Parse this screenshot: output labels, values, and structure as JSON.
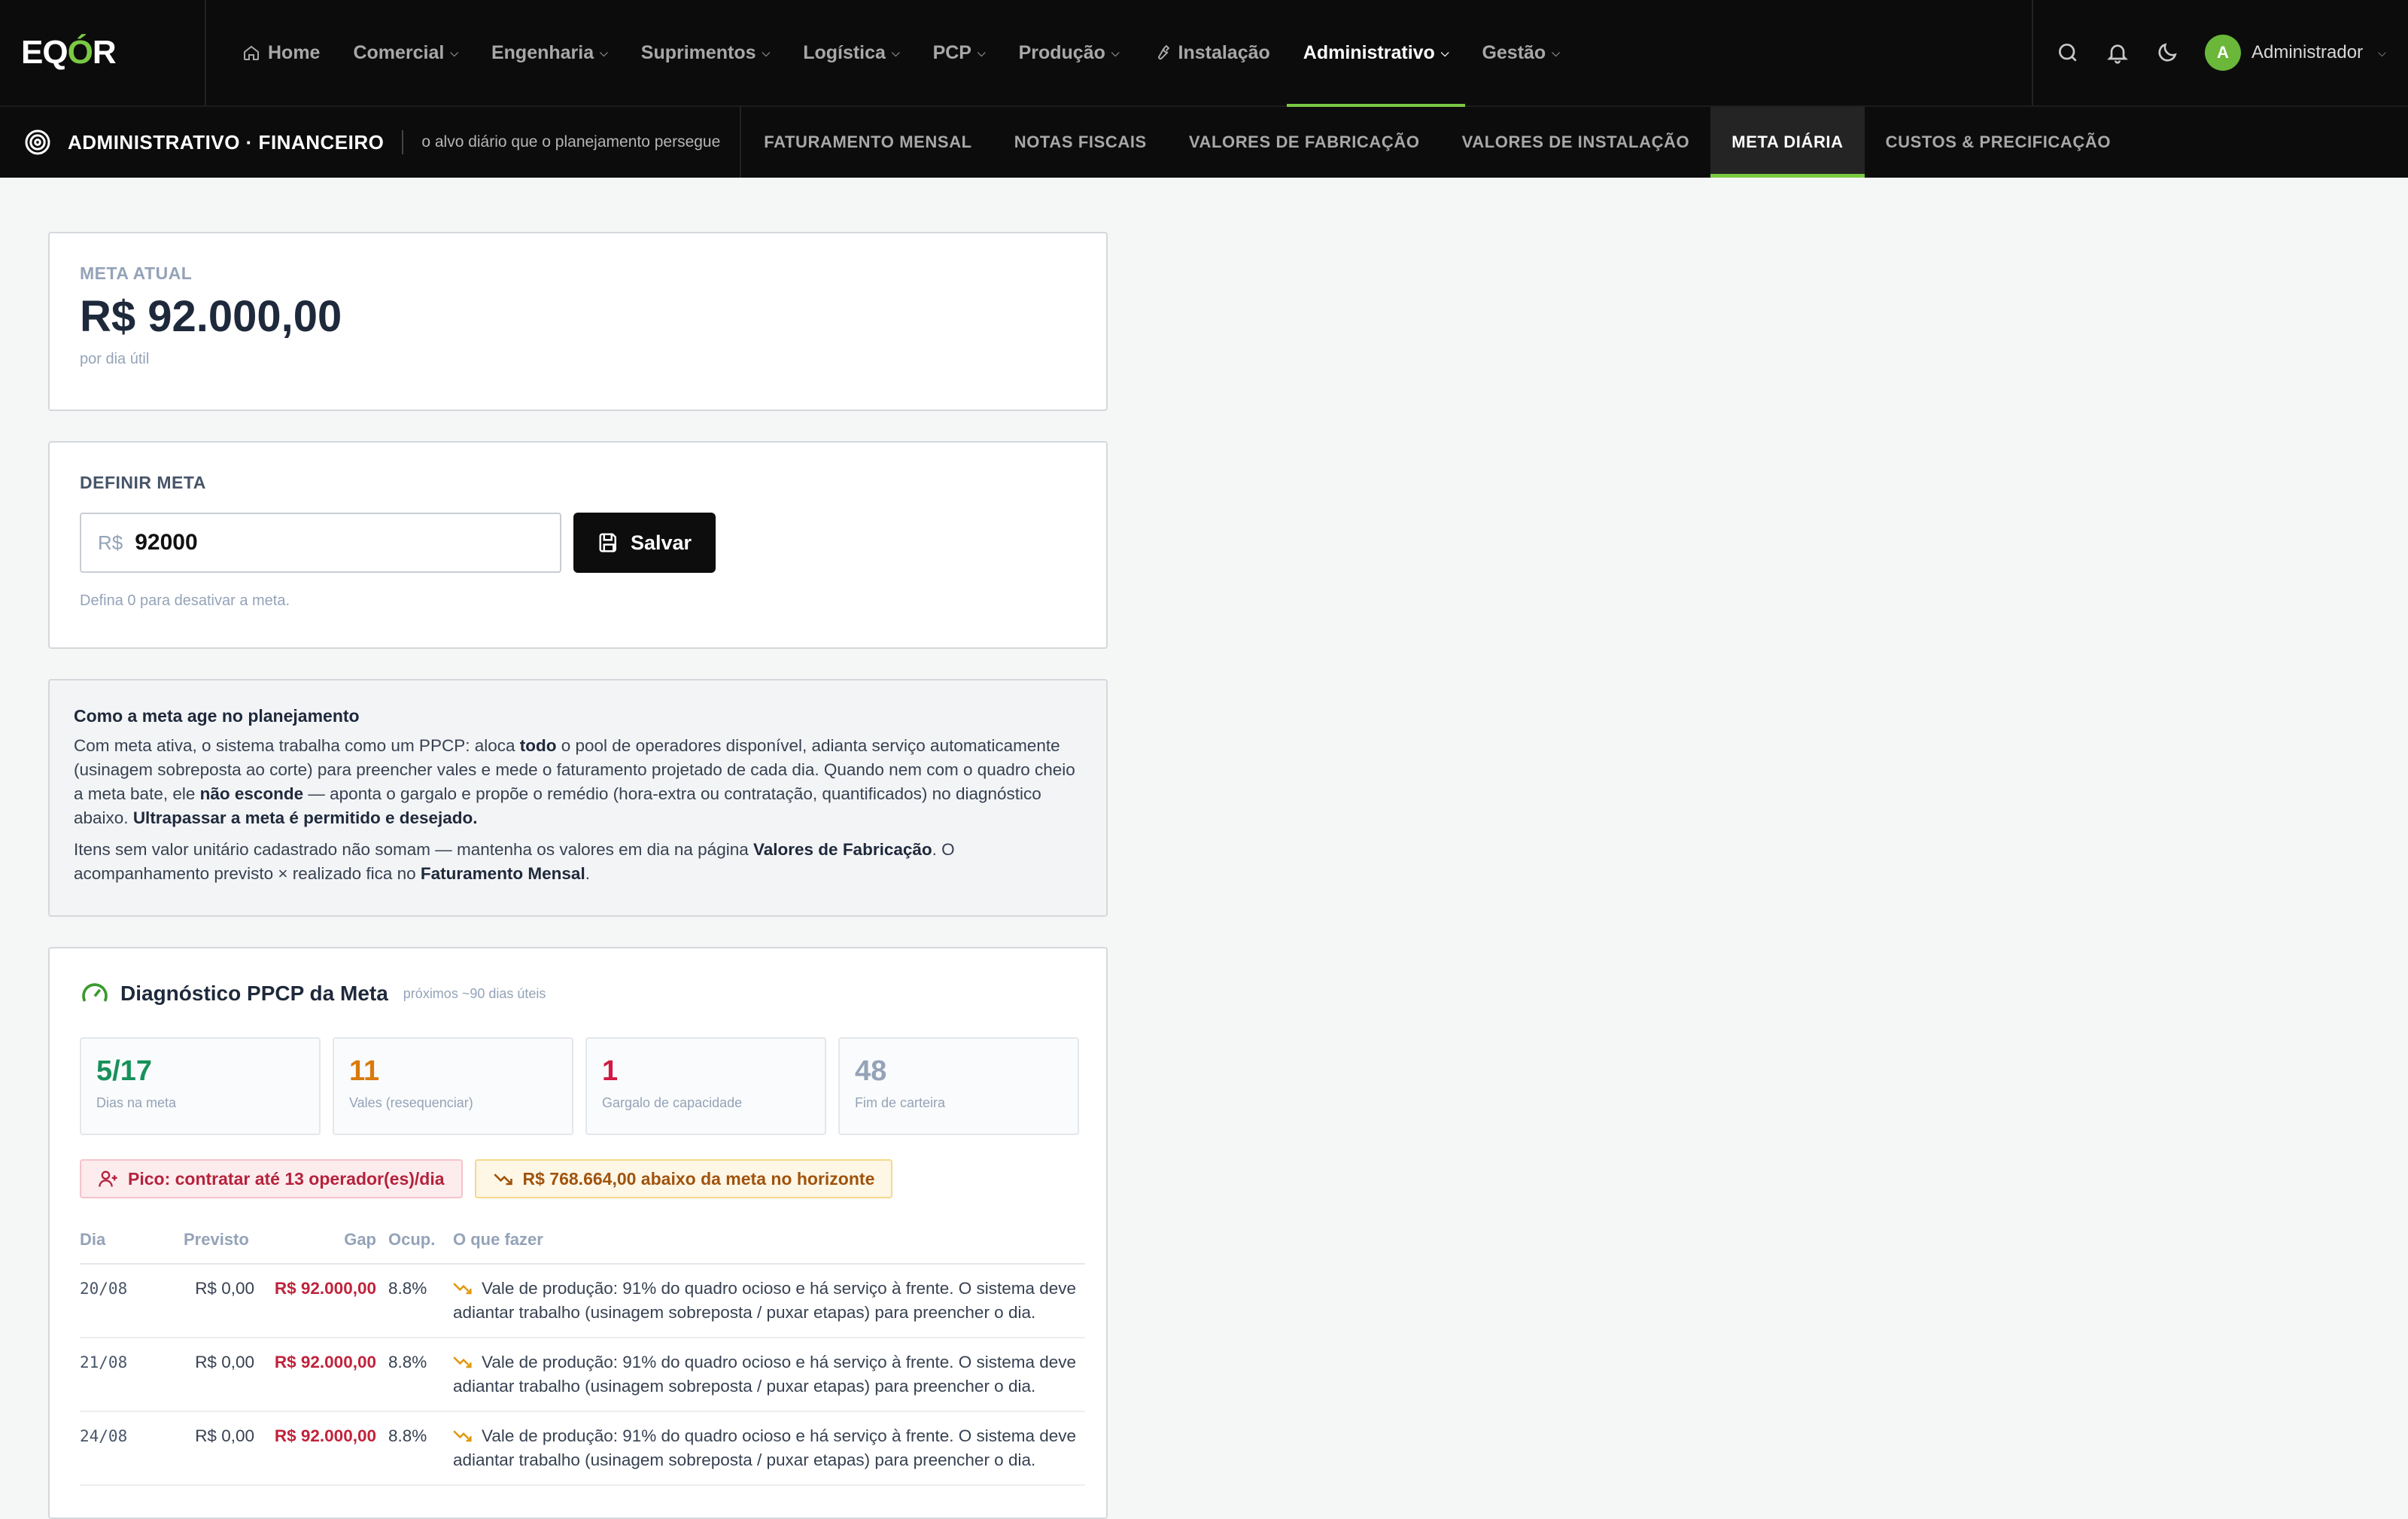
{
  "app": {
    "logo_text_1": "EQ",
    "logo_text_2": "Ó",
    "logo_text_3": "R"
  },
  "nav": {
    "items": [
      {
        "label": "Home",
        "icon": "home-icon"
      },
      {
        "label": "Comercial"
      },
      {
        "label": "Engenharia"
      },
      {
        "label": "Suprimentos"
      },
      {
        "label": "Logística"
      },
      {
        "label": "PCP"
      },
      {
        "label": "Produção"
      },
      {
        "label": "Instalação",
        "icon": "wrench-icon"
      },
      {
        "label": "Administrativo",
        "active": true
      },
      {
        "label": "Gestão"
      }
    ],
    "user": {
      "initial": "A",
      "name": "Administrador"
    }
  },
  "subnav": {
    "section_title": "ADMINISTRATIVO · FINANCEIRO",
    "section_subtitle": "o alvo diário que o planejamento persegue",
    "tabs": [
      {
        "label": "FATURAMENTO MENSAL"
      },
      {
        "label": "NOTAS FISCAIS"
      },
      {
        "label": "VALORES DE FABRICAÇÃO"
      },
      {
        "label": "VALORES DE INSTALAÇÃO"
      },
      {
        "label": "META DIÁRIA",
        "active": true
      },
      {
        "label": "CUSTOS & PRECIFICAÇÃO"
      }
    ]
  },
  "meta_atual": {
    "label": "META ATUAL",
    "value": "R$ 92.000,00",
    "unit": "por dia útil"
  },
  "definir_meta": {
    "label": "DEFINIR META",
    "prefix": "R$",
    "value": "92000",
    "save_label": "Salvar",
    "hint": "Defina 0 para desativar a meta."
  },
  "info": {
    "title": "Como a meta age no planejamento",
    "p1_a": "Com meta ativa, o sistema trabalha como um PPCP: aloca ",
    "p1_b": "todo",
    "p1_c": " o pool de operadores disponível, adianta serviço automaticamente (usinagem sobreposta ao corte) para preencher vales e mede o faturamento projetado de cada dia. Quando nem com o quadro cheio a meta bate, ele ",
    "p1_d": "não esconde",
    "p1_e": " — aponta o gargalo e propõe o remédio (hora-extra ou contratação, quantificados) no diagnóstico abaixo. ",
    "p1_f": "Ultrapassar a meta é permitido e desejado.",
    "p2_a": "Itens sem valor unitário cadastrado não somam — mantenha os valores em dia na página ",
    "p2_b": "Valores de Fabricação",
    "p2_c": ". O acompanhamento previsto × realizado fica no ",
    "p2_d": "Faturamento Mensal",
    "p2_e": "."
  },
  "diagnostico": {
    "title": "Diagnóstico PPCP da Meta",
    "subtitle": "próximos ~90 dias úteis",
    "stats": [
      {
        "value": "5/17",
        "label": "Dias na meta",
        "color": "#16915a"
      },
      {
        "value": "11",
        "label": "Vales (resequenciar)",
        "color": "#d97a0b"
      },
      {
        "value": "1",
        "label": "Gargalo de capacidade",
        "color": "#d11a44"
      },
      {
        "value": "48",
        "label": "Fim de carteira",
        "color": "#94a3b8"
      }
    ],
    "badge_hire": "Pico: contratar até 13 operador(es)/dia",
    "badge_gap": "R$ 768.664,00 abaixo da meta no horizonte",
    "columns": {
      "dia": "Dia",
      "previsto": "Previsto",
      "gap": "Gap",
      "ocup": "Ocup.",
      "acao": "O que fazer"
    },
    "rows": [
      {
        "dia": "20/08",
        "previsto": "R$ 0,00",
        "gap": "R$ 92.000,00",
        "ocup": "8.8%",
        "acao": "Vale de produção: 91% do quadro ocioso e há serviço à frente. O sistema deve adiantar trabalho (usinagem sobreposta / puxar etapas) para preencher o dia."
      },
      {
        "dia": "21/08",
        "previsto": "R$ 0,00",
        "gap": "R$ 92.000,00",
        "ocup": "8.8%",
        "acao": "Vale de produção: 91% do quadro ocioso e há serviço à frente. O sistema deve adiantar trabalho (usinagem sobreposta / puxar etapas) para preencher o dia."
      },
      {
        "dia": "24/08",
        "previsto": "R$ 0,00",
        "gap": "R$ 92.000,00",
        "ocup": "8.8%",
        "acao": "Vale de produção: 91% do quadro ocioso e há serviço à frente. O sistema deve adiantar trabalho (usinagem sobreposta / puxar etapas) para preencher o dia."
      }
    ]
  },
  "colors": {
    "accent": "#7ac943",
    "danger": "#c0223b",
    "warning": "#d97a0b",
    "success": "#16915a"
  }
}
